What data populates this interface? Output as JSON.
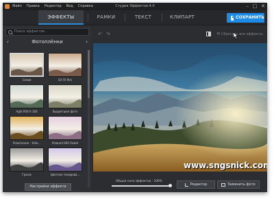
{
  "window": {
    "title": "Студия Эффектов 4.0",
    "menu": [
      "Файл",
      "Правка",
      "Редактор",
      "Вид",
      "Справка"
    ],
    "controls": {
      "minimize": "–",
      "maximize": "□",
      "close": "✕"
    }
  },
  "tabs": [
    {
      "label": "ЭФФЕКТЫ",
      "active": true
    },
    {
      "label": "РАМКИ",
      "active": false
    },
    {
      "label": "ТЕКСТ",
      "active": false
    },
    {
      "label": "КЛИПАРТ",
      "active": false
    }
  ],
  "save_button": {
    "label": "СОХРАНИТЬ",
    "icon": "floppy-disk-icon",
    "color": "#1d8ae6"
  },
  "sidebar": {
    "search_placeholder": "Поиск эффектов...",
    "category": "Фотоплёнки",
    "prev_arrow": "‹",
    "next_arrow": "›",
    "effects": [
      {
        "label": "Сепия",
        "selected": true,
        "sky": "#d9c8b3",
        "hills": "#6a5646"
      },
      {
        "label": "SX-70 film",
        "selected": false,
        "sky": "#c9a98c",
        "hills": "#7a5a48"
      },
      {
        "label": "Agfa RSX II 100",
        "selected": false,
        "sky": "#cfd8d3",
        "hills": "#536a57"
      },
      {
        "label": "Выцветшее фото",
        "selected": false,
        "sky": "#d8d7c8",
        "hills": "#7d8066"
      },
      {
        "label": "Polachrome - Yello...",
        "selected": false,
        "sky": "#e3b25a",
        "hills": "#6b4e1f"
      },
      {
        "label": "Polaroid 600 Faded",
        "selected": false,
        "sky": "#e6cfe0",
        "hills": "#8c6f86"
      },
      {
        "label": "Гранж",
        "selected": false,
        "sky": "#9a9a9a",
        "hills": "#3f3f3f"
      },
      {
        "label": "Цветное тонирова...",
        "selected": false,
        "sky": "#d2c7ea",
        "hills": "#65578c"
      }
    ],
    "settings_button": "Настройки эффекта"
  },
  "toolbar": {
    "undo_icon": "undo-icon",
    "redo_icon": "redo-icon",
    "compare_icon": "before-after-icon",
    "reset_label": "Сбросить все эффекты"
  },
  "canvas": {
    "watermark": "www.sngsnick.com"
  },
  "bottom": {
    "strength_label": "Общая сила эффектов - 100%",
    "strength_value": 100,
    "editor_button": "Редактор",
    "replace_button": "Заменить фото"
  }
}
